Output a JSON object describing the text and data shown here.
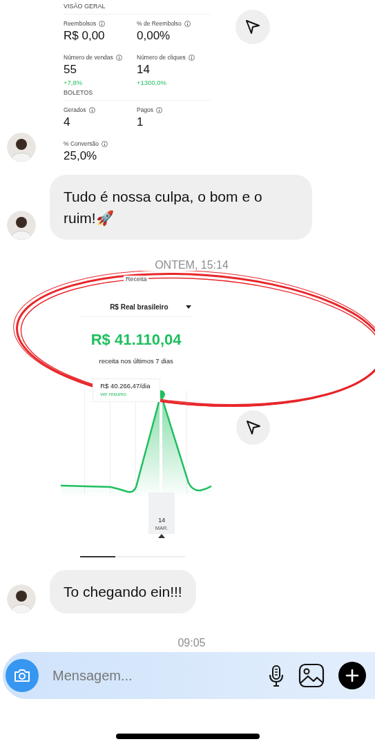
{
  "messages": [
    {
      "kind": "dashboard",
      "avatar": true,
      "share": true,
      "sections": [
        {
          "title": "VISÃO GERAL",
          "metrics": [
            {
              "label": "Reembolsos",
              "value": "R$ 0,00"
            },
            {
              "label": "% de Reembolso",
              "value": "0,00%"
            },
            {
              "label": "Número de vendas",
              "value": "55",
              "change": "+7,8%"
            },
            {
              "label": "Número de cliques",
              "value": "14",
              "change": "+1300,0%"
            }
          ]
        },
        {
          "title": "BOLETOS",
          "metrics": [
            {
              "label": "Gerados",
              "value": "4"
            },
            {
              "label": "Pagos",
              "value": "1"
            },
            {
              "label": "% Conversão",
              "value": "25,0%"
            }
          ]
        }
      ]
    },
    {
      "kind": "text",
      "avatar": true,
      "text": "Tudo é nossa culpa, o bom e o ruim!🚀"
    },
    {
      "kind": "time",
      "text": "ONTEM, 15:14"
    },
    {
      "kind": "revenue",
      "avatar": false,
      "share": true,
      "highlighted": true,
      "title": "Receita",
      "currency": "R$ Real brasileiro",
      "total": "R$ 41.110,04",
      "caption": "receita nos últimos 7 dias",
      "tooltip": "R$ 40.266,47/dia",
      "link": "ver resumo",
      "day": "14",
      "month": "MAR."
    },
    {
      "kind": "text",
      "avatar": true,
      "text": "To chegando ein!!!"
    },
    {
      "kind": "time",
      "text": "09:05"
    }
  ],
  "composer": {
    "placeholder": "Mensagem..."
  }
}
